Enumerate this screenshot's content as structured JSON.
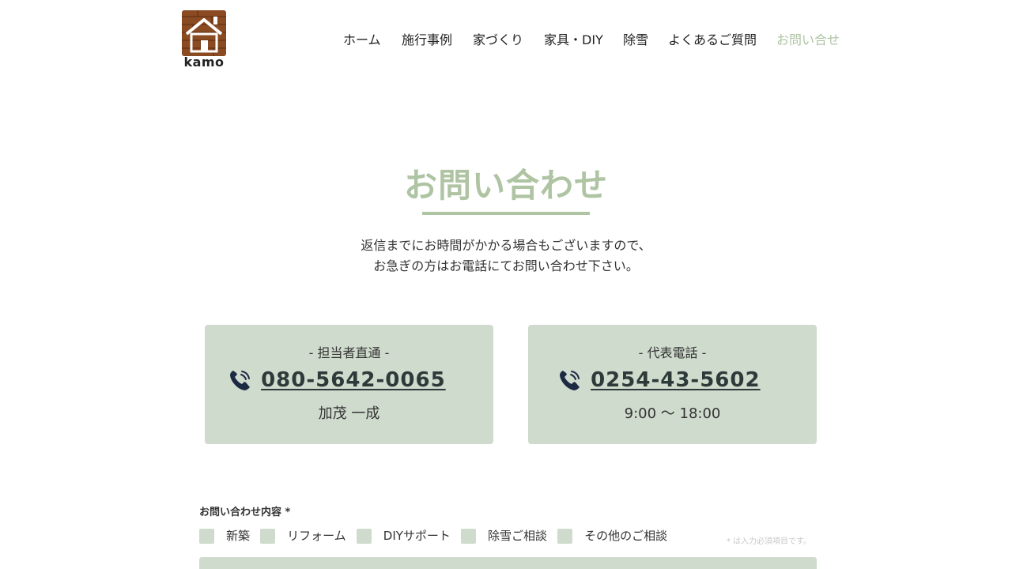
{
  "header": {
    "logo_text": "kamo",
    "nav": [
      {
        "label": "ホーム"
      },
      {
        "label": "施行事例"
      },
      {
        "label": "家づくり"
      },
      {
        "label": "家具・DIY"
      },
      {
        "label": "除雪"
      },
      {
        "label": "よくあるご質問"
      },
      {
        "label": "お問い合せ",
        "active": true
      }
    ]
  },
  "page": {
    "title": "お問い合わせ",
    "intro_line1": "返信までにお時間がかかる場合もございますので、",
    "intro_line2": "お急ぎの方はお電話にてお問い合わせ下さい。"
  },
  "contacts": [
    {
      "label": "- 担当者直通 -",
      "number": "080-5642-0065",
      "note": "加茂 一成",
      "icon": "phone-icon"
    },
    {
      "label": "- 代表電話 -",
      "number": "0254-43-5602",
      "note": "9:00 〜 18:00",
      "icon": "phone-icon"
    }
  ],
  "form": {
    "inquiry_label": "お問い合わせ内容 *",
    "options": [
      "新築",
      "リフォーム",
      "DIYサポート",
      "除雪ご相談",
      "その他のご相談"
    ],
    "required_note": "* は入力必須項目です。"
  },
  "colors": {
    "accent": "#aec4a3",
    "card_bg": "#cfdbcc",
    "text": "#333333",
    "phone_icon": "#1d2a44"
  }
}
